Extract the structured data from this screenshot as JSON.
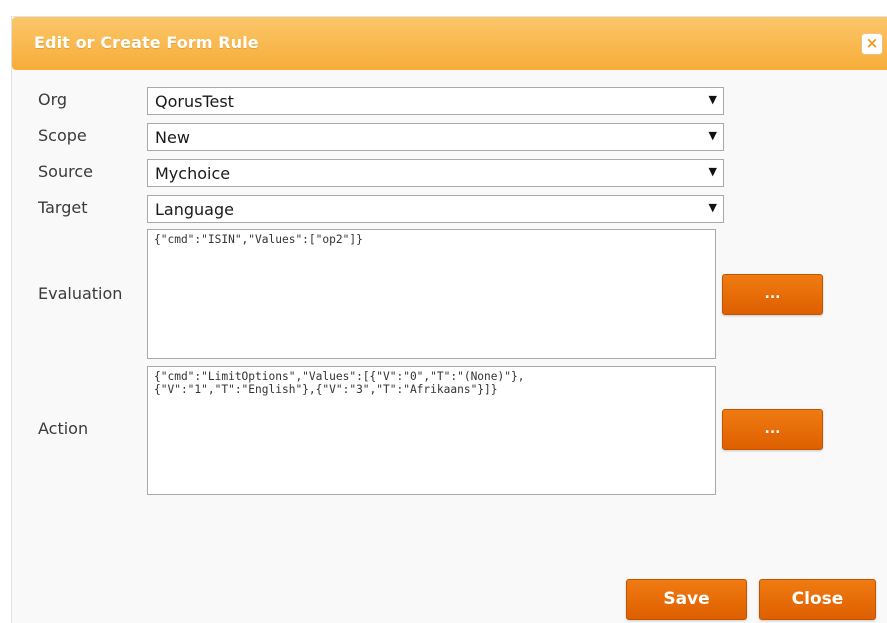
{
  "dialog": {
    "title": "Edit or Create Form Rule",
    "close_label": "×"
  },
  "form": {
    "org": {
      "label": "Org",
      "value": "QorusTest"
    },
    "scope": {
      "label": "Scope",
      "value": "New"
    },
    "source": {
      "label": "Source",
      "value": "Mychoice"
    },
    "target": {
      "label": "Target",
      "value": "Language"
    },
    "evaluation": {
      "label": "Evaluation",
      "value": "{\"cmd\":\"ISIN\",\"Values\":[\"op2\"]}",
      "button_label": "..."
    },
    "action": {
      "label": "Action",
      "value": "{\"cmd\":\"LimitOptions\",\"Values\":[{\"V\":\"0\",\"T\":\"(None)\"},\n{\"V\":\"1\",\"T\":\"English\"},{\"V\":\"3\",\"T\":\"Afrikaans\"}]}",
      "button_label": "..."
    }
  },
  "footer": {
    "save_label": "Save",
    "close_label": "Close"
  },
  "dropdown_arrow": "▼",
  "colors": {
    "titlebar": "#f7ad38",
    "button": "#e86a06"
  }
}
